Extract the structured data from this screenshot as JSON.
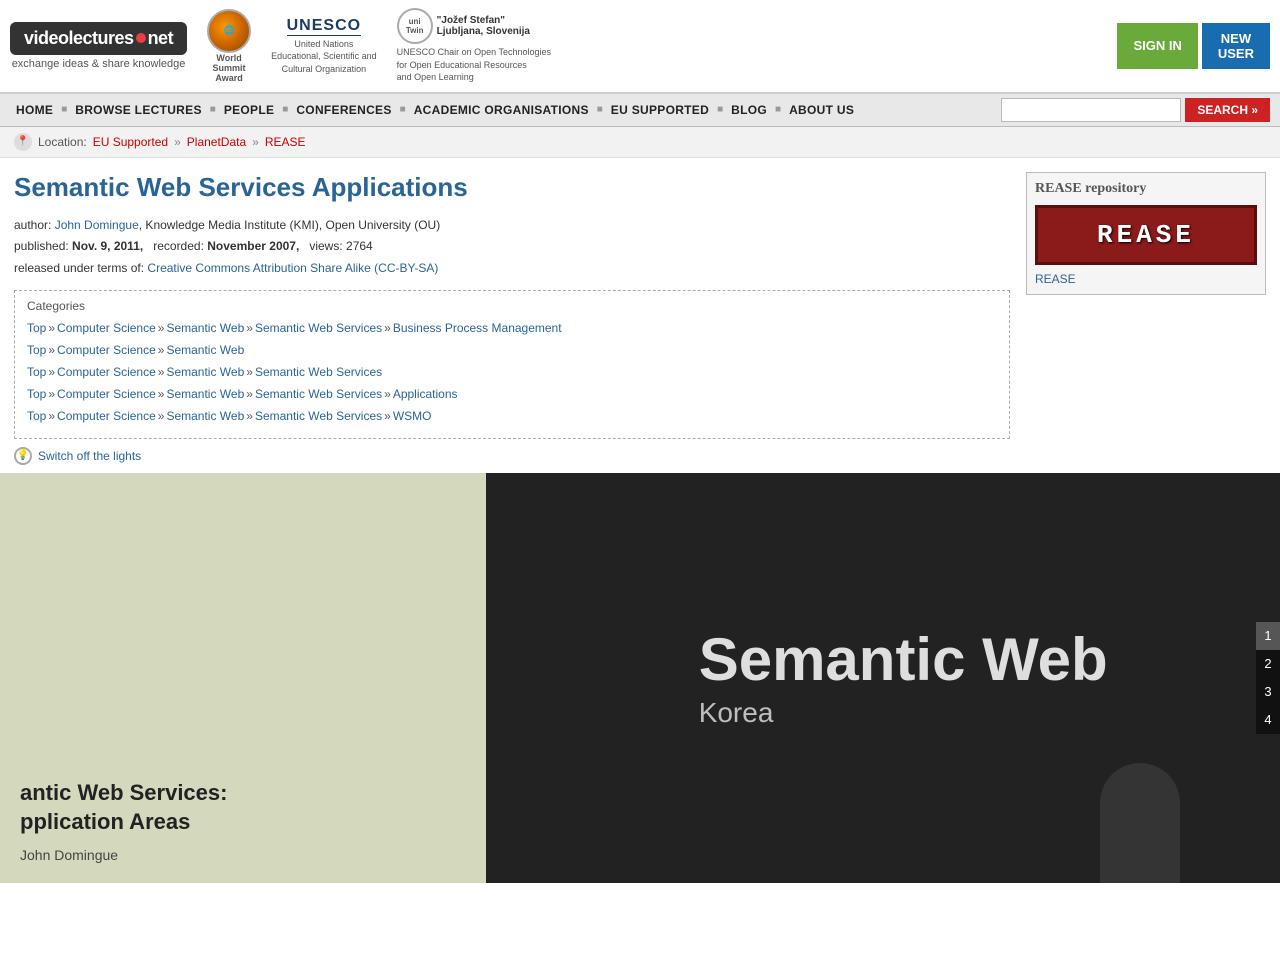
{
  "header": {
    "logo_text": "videolectures",
    "logo_suffix": ".net",
    "tagline": "exchange ideas & share knowledge",
    "award_text": "World Summit Award",
    "unesco_label": "UNESCO",
    "unesco_sub": "United Nations\nEducational, Scientific and\nCultural Organization",
    "unitwin_label": "uni Twin",
    "unitwin_sub": "\"Jožef Stefan\"\nLjubljana, Slovenija",
    "unitwin_desc": "UNESCO Chair on Open Technologies\nfor Open Educational Resources\nand Open Learning",
    "signin_label": "SIGN IN",
    "newuser_label": "NEW\nUSER"
  },
  "nav": {
    "items": [
      {
        "label": "HOME",
        "id": "home"
      },
      {
        "label": "BROWSE LECTURES",
        "id": "browse"
      },
      {
        "label": "PEOPLE",
        "id": "people"
      },
      {
        "label": "CONFERENCES",
        "id": "conferences"
      },
      {
        "label": "ACADEMIC ORGANISATIONS",
        "id": "academic"
      },
      {
        "label": "EU SUPPORTED",
        "id": "eu"
      },
      {
        "label": "BLOG",
        "id": "blog"
      },
      {
        "label": "ABOUT US",
        "id": "about"
      }
    ],
    "search_placeholder": "",
    "search_label": "SEARCH »"
  },
  "breadcrumb": {
    "prefix": "Location:",
    "items": [
      {
        "label": "EU Supported",
        "href": "#"
      },
      {
        "label": "PlanetData",
        "href": "#"
      },
      {
        "label": "REASE",
        "href": "#"
      }
    ]
  },
  "lecture": {
    "title": "Semantic Web Services Applications",
    "author_label": "author:",
    "author_name": "John Domingue",
    "author_affiliation": ", Knowledge Media Institute (KMI), Open University (OU)",
    "published_label": "published:",
    "published_date": "Nov. 9, 2011,",
    "recorded_label": "recorded:",
    "recorded_date": "November 2007,",
    "views_label": "views:",
    "views_count": "2764",
    "released_label": "released under terms of:",
    "license_label": "Creative Commons Attribution Share Alike (CC-BY-SA)",
    "categories_title": "Categories",
    "categories": [
      {
        "items": [
          {
            "label": "Top",
            "href": "#"
          },
          {
            "label": "Computer Science",
            "href": "#"
          },
          {
            "label": "Semantic Web",
            "href": "#"
          },
          {
            "label": "Semantic Web Services",
            "href": "#"
          },
          {
            "label": "Business Process Management",
            "href": "#"
          }
        ]
      },
      {
        "items": [
          {
            "label": "Top",
            "href": "#"
          },
          {
            "label": "Computer Science",
            "href": "#"
          },
          {
            "label": "Semantic Web",
            "href": "#"
          }
        ]
      },
      {
        "items": [
          {
            "label": "Top",
            "href": "#"
          },
          {
            "label": "Computer Science",
            "href": "#"
          },
          {
            "label": "Semantic Web",
            "href": "#"
          },
          {
            "label": "Semantic Web Services",
            "href": "#"
          }
        ]
      },
      {
        "items": [
          {
            "label": "Top",
            "href": "#"
          },
          {
            "label": "Computer Science",
            "href": "#"
          },
          {
            "label": "Semantic Web",
            "href": "#"
          },
          {
            "label": "Semantic Web Services",
            "href": "#"
          },
          {
            "label": "Applications",
            "href": "#"
          }
        ]
      },
      {
        "items": [
          {
            "label": "Top",
            "href": "#"
          },
          {
            "label": "Computer Science",
            "href": "#"
          },
          {
            "label": "Semantic Web",
            "href": "#"
          },
          {
            "label": "Semantic Web Services",
            "href": "#"
          },
          {
            "label": "WSMO",
            "href": "#"
          }
        ]
      }
    ]
  },
  "sidebar": {
    "rease_title": "REASE repository",
    "rease_logo_text": "REASE",
    "rease_link_label": "REASE"
  },
  "lights": {
    "label": "Switch off the lights"
  },
  "video": {
    "slide_title": "antic Web Services:\npplication Areas",
    "slide_author": "John Domingue",
    "big_text": "Semantic Web",
    "korea_text": "Korea",
    "numbers": [
      "1",
      "2",
      "3",
      "4"
    ]
  }
}
